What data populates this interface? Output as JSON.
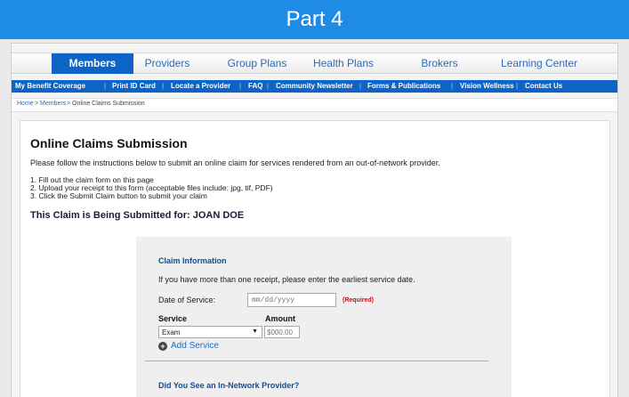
{
  "banner": {
    "title": "Part 4"
  },
  "topnav": {
    "tabs": [
      {
        "label": "Members",
        "active": true
      },
      {
        "label": "Providers"
      },
      {
        "label": "Group Plans"
      },
      {
        "label": "Health Plans"
      },
      {
        "label": "Brokers"
      },
      {
        "label": "Learning Center"
      }
    ]
  },
  "subnav": {
    "items": [
      "My Benefit Coverage",
      "Print ID Card",
      "Locate a Provider",
      "FAQ",
      "Community Newsletter",
      "Forms & Publications",
      "Vision Wellness",
      "Contact Us"
    ],
    "separator": "|"
  },
  "breadcrumb": {
    "home": "Home",
    "members": "Members",
    "current": "Online Claims Submission",
    "sep": ">"
  },
  "page": {
    "title": "Online Claims Submission",
    "intro": "Please follow the instructions below to submit an online claim for services rendered from an out-of-network provider.",
    "steps": [
      "1. Fill out the claim form on this page",
      "2. Upload your receipt to this form (acceptable files include: jpg, tif, PDF)",
      "3. Click the Submit Claim button to submit your claim"
    ],
    "claim_for": "This Claim is Being Submitted for: JOAN DOE"
  },
  "form": {
    "section_title": "Claim Information",
    "note": "If you have more than one receipt, please enter the earliest service date.",
    "date_label": "Date of Service:",
    "date_placeholder": "mm/dd/yyyy",
    "required": "(Required)",
    "service_header": "Service",
    "amount_header": "Amount",
    "service_value": "Exam",
    "amount_placeholder": "$000.00",
    "add_service": "Add Service",
    "section2_title": "Did You See an In-Network Provider?"
  },
  "colors": {
    "banner": "#1e8ce6",
    "nav_active": "#0e63c7",
    "link": "#1e6cc4",
    "required": "#c0121a"
  },
  "icons": {
    "add": "plus-circle-icon",
    "dropdown": "chevron-down-icon"
  }
}
